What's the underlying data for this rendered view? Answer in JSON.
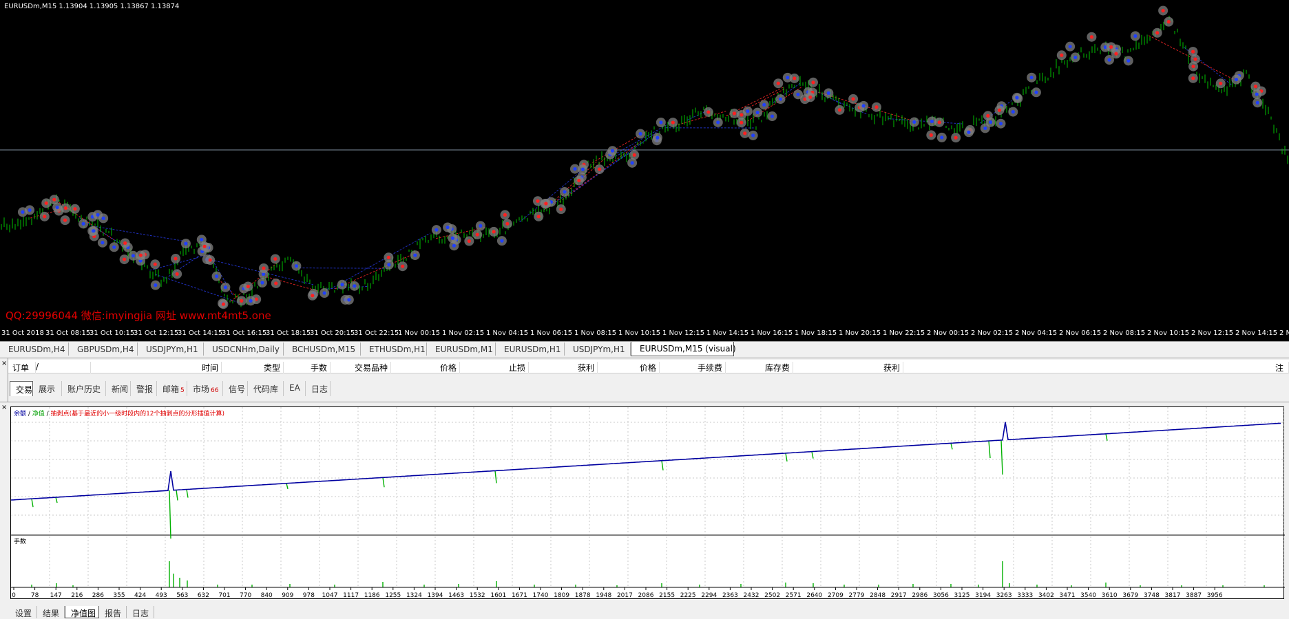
{
  "chart": {
    "header": "EURUSDm,M15  1.13904 1.13905 1.13867 1.13874",
    "watermark": "QQ:29996044 微信:imyingjia 网址 www.mt4mt5.one",
    "time_labels": [
      "31 Oct 2018",
      "31 Oct 08:15",
      "31 Oct 10:15",
      "31 Oct 12:15",
      "31 Oct 14:15",
      "31 Oct 16:15",
      "31 Oct 18:15",
      "31 Oct 20:15",
      "31 Oct 22:15",
      "1 Nov 00:15",
      "1 Nov 02:15",
      "1 Nov 04:15",
      "1 Nov 06:15",
      "1 Nov 08:15",
      "1 Nov 10:15",
      "1 Nov 12:15",
      "1 Nov 14:15",
      "1 Nov 16:15",
      "1 Nov 18:15",
      "1 Nov 20:15",
      "1 Nov 22:15",
      "2 Nov 00:15",
      "2 Nov 02:15",
      "2 Nov 04:15",
      "2 Nov 06:15",
      "2 Nov 08:15",
      "2 Nov 10:15",
      "2 Nov 12:15",
      "2 Nov 14:15",
      "2 N"
    ],
    "colors": {
      "bg": "#000000",
      "candle": "#00c000",
      "buy_marker": "#ff2020",
      "sell_marker": "#2040ff",
      "marker_ring": "#808080",
      "hline": "#8090a0"
    }
  },
  "chart_tabs": [
    "EURUSDm,H4",
    "GBPUSDm,H4",
    "USDJPYm,H1",
    "USDCNHm,Daily",
    "BCHUSDm,M15",
    "ETHUSDm,H1",
    "EURUSDm,M1",
    "EURUSDm,H1",
    "USDJPYm,H1",
    "EURUSDm,M15 (visual)"
  ],
  "orders": {
    "columns": [
      "订单",
      "/",
      "时间",
      "类型",
      "手数",
      "交易品种",
      "价格",
      "止损",
      "获利",
      "价格",
      "手续费",
      "库存费",
      "获利",
      "注"
    ]
  },
  "terminal_tabs": [
    {
      "label": "交易"
    },
    {
      "label": "展示"
    },
    {
      "label": "账户历史"
    },
    {
      "label": "新闻"
    },
    {
      "label": "警报"
    },
    {
      "label": "邮箱",
      "badge": "5"
    },
    {
      "label": "市场",
      "badge": "66"
    },
    {
      "label": "信号"
    },
    {
      "label": "代码库"
    },
    {
      "label": "EA"
    },
    {
      "label": "日志"
    }
  ],
  "tester": {
    "legend": {
      "balance": "余额",
      "sep1": " / ",
      "equity": "净值",
      "sep2": " / ",
      "drawdown": "抽剥点(基于最近的小一级时段内的12个抽剥点的分形插值计算)"
    },
    "lots_label": "手数",
    "x_ticks": [
      "0",
      "78",
      "147",
      "216",
      "286",
      "355",
      "424",
      "493",
      "563",
      "632",
      "701",
      "770",
      "840",
      "909",
      "978",
      "1047",
      "1117",
      "1186",
      "1255",
      "1324",
      "1394",
      "1463",
      "1532",
      "1601",
      "1671",
      "1740",
      "1809",
      "1878",
      "1948",
      "2017",
      "2086",
      "2155",
      "2225",
      "2294",
      "2363",
      "2432",
      "2502",
      "2571",
      "2640",
      "2709",
      "2779",
      "2848",
      "2917",
      "2986",
      "3056",
      "3125",
      "3194",
      "3263",
      "3333",
      "3402",
      "3471",
      "3540",
      "3610",
      "3679",
      "3748",
      "3817",
      "3887",
      "3956"
    ],
    "colors": {
      "balance": "#0000a0",
      "equity": "#00b000",
      "lots": "#00b000",
      "grid": "#c8c8c8"
    }
  },
  "bottom_tabs": [
    "设置",
    "结果",
    "净值图",
    "报告",
    "日志"
  ],
  "term_labels": {
    "close": "×",
    "vertical": "终端",
    "tester_vertical": "策略测试"
  }
}
